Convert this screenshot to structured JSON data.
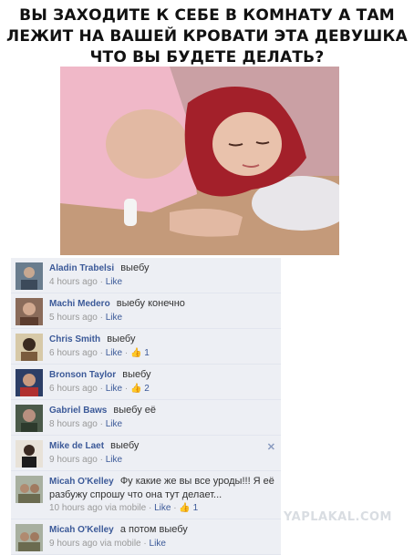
{
  "headline": {
    "line1": "ВЫ ЗАХОДИТЕ К СЕБЕ В КОМНАТУ А ТАМ",
    "line2": "ЛЕЖИТ НА ВАШЕЙ КРОВАТИ ЭТА ДЕВУШКА",
    "line3": "ЧТО ВЫ БУДЕТЕ ДЕЛАТЬ?"
  },
  "comments": [
    {
      "author": "Aladin Trabelsi",
      "text": "выебу",
      "time": "4 hours ago",
      "sep": "·",
      "like": "Like",
      "likes": ""
    },
    {
      "author": "Machi Medero",
      "text": "выебу конечно",
      "time": "5 hours ago",
      "sep": "·",
      "like": "Like",
      "likes": ""
    },
    {
      "author": "Chris Smith",
      "text": "выебу",
      "time": "6 hours ago",
      "sep": "·",
      "like": "Like",
      "likes": "1"
    },
    {
      "author": "Bronson Taylor",
      "text": "выебу",
      "time": "6 hours ago",
      "sep": "·",
      "like": "Like",
      "likes": "2"
    },
    {
      "author": "Gabriel Baws",
      "text": "выебу её",
      "time": "8 hours ago",
      "sep": "·",
      "like": "Like",
      "likes": ""
    },
    {
      "author": "Mike de Laet",
      "text": "выебу",
      "time": "9 hours ago",
      "sep": "·",
      "like": "Like",
      "likes": ""
    },
    {
      "author": "Micah O'Kelley",
      "text": "Фу какие же вы все уроды!!! Я её разбужу спрошу что она тут делает...",
      "time": "10 hours ago via mobile",
      "sep": "·",
      "like": "Like",
      "likes": "1"
    },
    {
      "author": "Micah O'Kelley",
      "text": "а потом выебу",
      "time": "9 hours ago via mobile",
      "sep": "·",
      "like": "Like",
      "likes": ""
    }
  ],
  "close_glyph": "✕",
  "thumb_glyph": "👍",
  "watermark": "YAPLAKAL.COM",
  "colors": {
    "link": "#3b5998",
    "comment_bg": "#edeff4",
    "meta": "#999999"
  }
}
